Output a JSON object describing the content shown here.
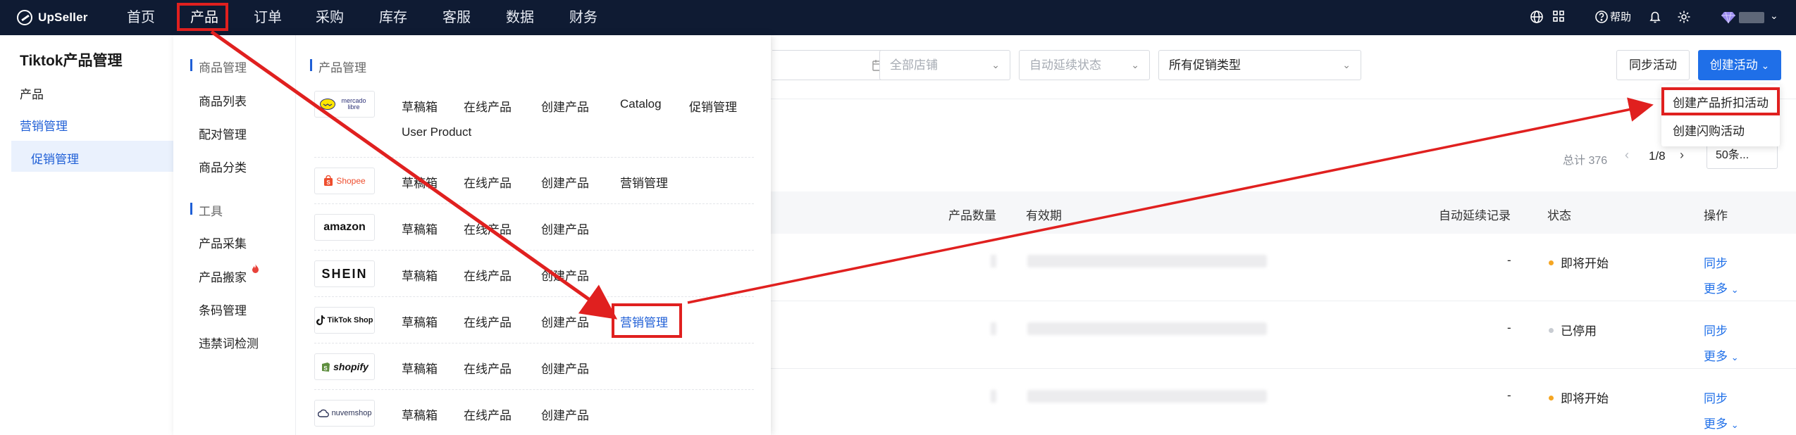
{
  "topnav": {
    "logo": "UpSeller",
    "items": [
      "首页",
      "产品",
      "订单",
      "采购",
      "库存",
      "客服",
      "数据",
      "财务"
    ],
    "active": "产品",
    "help": "帮助"
  },
  "sidebar": {
    "title": "Tiktok产品管理",
    "items": [
      "产品",
      "营销管理",
      "促销管理"
    ]
  },
  "filters": {
    "shop": "全部店铺",
    "auto_extend": "自动延续状态",
    "promo_type": "所有促销类型",
    "sync_button": "同步活动",
    "create_button": "创建活动"
  },
  "dropdown": {
    "items": [
      "创建产品折扣活动",
      "创建闪购活动"
    ]
  },
  "pager": {
    "total": "总计 376",
    "page": "1/8",
    "size": "50条..."
  },
  "table": {
    "headers": [
      "产品数量",
      "有效期",
      "自动延续记录",
      "状态",
      "操作"
    ],
    "rows": [
      {
        "auto": "-",
        "status": "即将开始",
        "status_color": "#f5a623",
        "op1": "同步",
        "op2": "更多"
      },
      {
        "auto": "-",
        "status": "已停用",
        "status_color": "#c8ccd2",
        "op1": "同步",
        "op2": "更多"
      },
      {
        "auto": "-",
        "status": "即将开始",
        "status_color": "#f5a623",
        "op1": "同步",
        "op2": "更多"
      }
    ]
  },
  "mega_menu": {
    "left_sections": [
      {
        "title": "商品管理",
        "items": [
          "商品列表",
          "配对管理",
          "商品分类"
        ]
      },
      {
        "title": "工具",
        "items": [
          "产品采集",
          "产品搬家",
          "条码管理",
          "违禁词检测"
        ]
      }
    ],
    "right_title": "产品管理",
    "platforms": [
      {
        "logo": "mercado libre",
        "links": [
          "草稿箱",
          "在线产品",
          "创建产品",
          "Catalog",
          "促销管理",
          "User Product"
        ]
      },
      {
        "logo": "Shopee",
        "links": [
          "草稿箱",
          "在线产品",
          "创建产品",
          "营销管理"
        ]
      },
      {
        "logo": "amazon",
        "links": [
          "草稿箱",
          "在线产品",
          "创建产品"
        ]
      },
      {
        "logo": "SHEIN",
        "links": [
          "草稿箱",
          "在线产品",
          "创建产品"
        ]
      },
      {
        "logo": "TikTok Shop",
        "links": [
          "草稿箱",
          "在线产品",
          "创建产品",
          "营销管理"
        ]
      },
      {
        "logo": "shopify",
        "links": [
          "草稿箱",
          "在线产品",
          "创建产品"
        ]
      },
      {
        "logo": "nuvemshop",
        "links": [
          "草稿箱",
          "在线产品",
          "创建产品"
        ]
      }
    ]
  },
  "colors": {
    "topbar": "#0f1b33",
    "accent": "#1f6fe8",
    "annotation": "#e0201f"
  }
}
